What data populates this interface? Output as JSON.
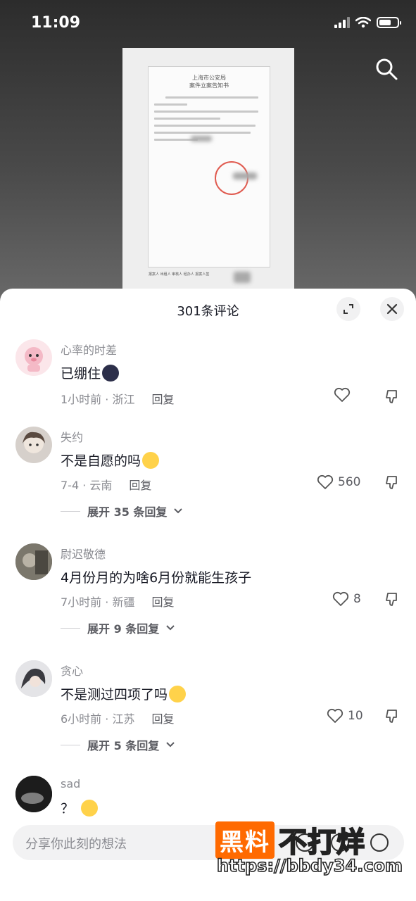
{
  "status_bar": {
    "time": "11:09"
  },
  "sheet": {
    "title": "301条评论"
  },
  "comments": [
    {
      "name": "心率的时差",
      "text": "已绷住",
      "meta_time_location": "1小时前 · 浙江",
      "reply_label": "回复",
      "likes": ""
    },
    {
      "name": "失约",
      "text": "不是自愿的吗",
      "meta_time_location": "7-4 · 云南",
      "reply_label": "回复",
      "likes": "560",
      "expand_label": "展开 35 条回复"
    },
    {
      "name": "尉迟敬德",
      "text": "4月份月的为啥6月份就能生孩子",
      "meta_time_location": "7小时前 · 新疆",
      "reply_label": "回复",
      "likes": "8",
      "expand_label": "展开 9 条回复"
    },
    {
      "name": "贪心",
      "text": "不是测过四项了吗",
      "meta_time_location": "6小时前 · 江苏",
      "reply_label": "回复",
      "likes": "10",
      "expand_label": "展开 5 条回复"
    },
    {
      "name": "sad",
      "text": "？"
    }
  ],
  "input": {
    "placeholder": "分享你此刻的想法"
  },
  "watermark": {
    "box_text": "黑料",
    "text": "不打烊",
    "url": "https://bbdy34.com"
  },
  "document": {
    "title_line1": "上海市公安局",
    "title_line2": "案件立案告知书",
    "footer": "报案人  出租人  审核人  经办人  报案人签"
  },
  "colors": {
    "accent": "#ff6a00",
    "text_primary": "#161823",
    "text_secondary": "#8a8b91"
  }
}
